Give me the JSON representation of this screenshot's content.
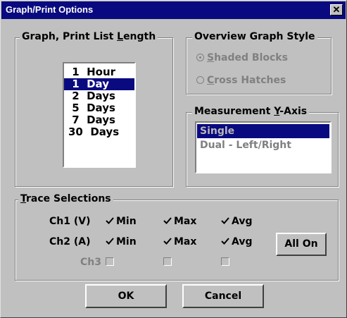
{
  "window": {
    "title": "Graph/Print Options",
    "close_label": "✕"
  },
  "length_group": {
    "legend_prefix": "Graph, Print List ",
    "legend_mnemonic": "L",
    "legend_suffix": "ength",
    "items": [
      {
        "label": " 1  Hour",
        "selected": false
      },
      {
        "label": " 1  Day",
        "selected": true
      },
      {
        "label": " 2  Days",
        "selected": false
      },
      {
        "label": " 5  Days",
        "selected": false
      },
      {
        "label": " 7  Days",
        "selected": false
      },
      {
        "label": "30  Days",
        "selected": false
      }
    ]
  },
  "overview_group": {
    "legend": "Overview Graph Style",
    "options": [
      {
        "mnemonic": "S",
        "rest": "haded Blocks",
        "checked": true
      },
      {
        "mnemonic": "C",
        "rest": "ross Hatches",
        "checked": false
      }
    ]
  },
  "measurement_group": {
    "legend_prefix": "Measurement ",
    "legend_mnemonic": "Y",
    "legend_suffix": "-Axis",
    "items": [
      {
        "label": "Single",
        "selected": true
      },
      {
        "label": "Dual - Left/Right",
        "selected": false
      }
    ]
  },
  "trace_group": {
    "legend_mnemonic": "T",
    "legend_suffix": "race Selections",
    "rows": [
      {
        "label": "Ch1 (V)",
        "min": "Min",
        "max": "Max",
        "avg": "Avg"
      },
      {
        "label": "Ch2 (A)",
        "min": "Min",
        "max": "Max",
        "avg": "Avg"
      },
      {
        "label": "Ch3",
        "min": "",
        "max": "",
        "avg": ""
      }
    ],
    "all_on_label": "All On"
  },
  "buttons": {
    "ok_label": "OK",
    "cancel_label": "Cancel"
  },
  "colors": {
    "title_bar": "#0a0a80",
    "face": "#c0c0c0",
    "selection": "#0a0a80"
  }
}
